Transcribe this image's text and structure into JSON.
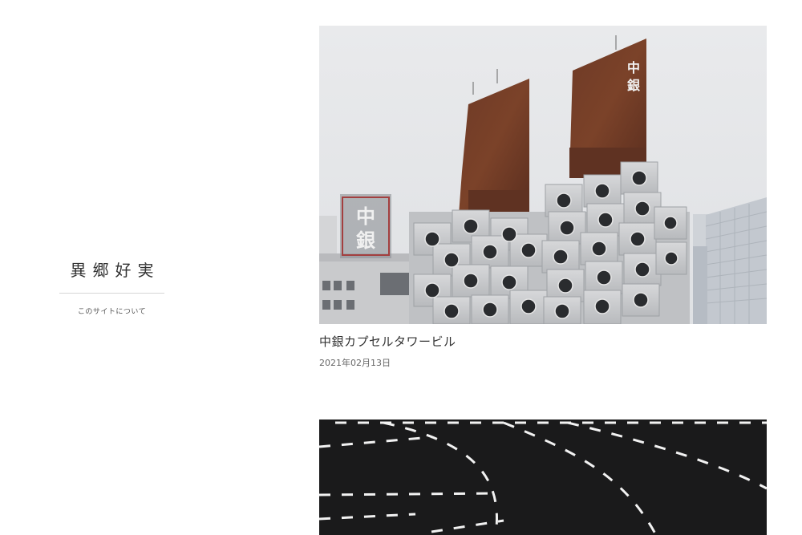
{
  "sidebar": {
    "site_title": "異郷好実",
    "about_link": "このサイトについて"
  },
  "posts": [
    {
      "title": "中銀カプセルタワービル",
      "date": "2021年02月13日",
      "image": {
        "sign_right": "中銀",
        "sign_left": "中銀"
      }
    },
    {
      "image": {}
    }
  ]
}
